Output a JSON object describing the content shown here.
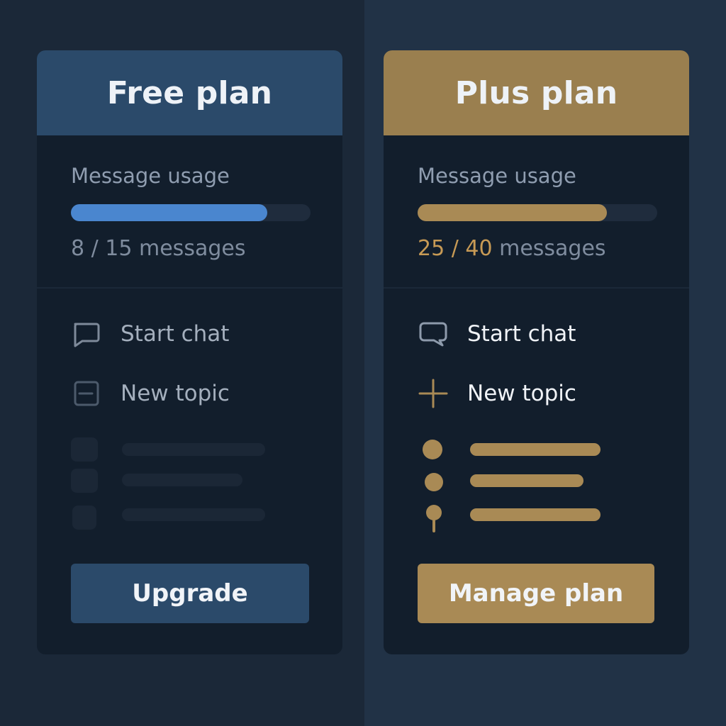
{
  "free": {
    "title": "Free plan",
    "usage_label": "Message usage",
    "used": "8",
    "separator": " / ",
    "limit": "15",
    "unit": " messages",
    "fill_fraction": 0.82,
    "items": [
      {
        "label": "Start chat",
        "icon": "chat-bubble-icon"
      },
      {
        "label": "New topic",
        "icon": "topic-card-icon"
      }
    ],
    "cta_label": "Upgrade",
    "accent": "#2b4a6a"
  },
  "plus": {
    "title": "Plus plan",
    "usage_label": "Message usage",
    "used": "25",
    "separator": " / ",
    "limit": "40",
    "unit": " messages",
    "fill_fraction": 0.79,
    "items": [
      {
        "label": "Start chat",
        "icon": "chat-bubble-icon"
      },
      {
        "label": "New topic",
        "icon": "plus-icon"
      }
    ],
    "cta_label": "Manage plan",
    "accent": "#a98a55"
  }
}
